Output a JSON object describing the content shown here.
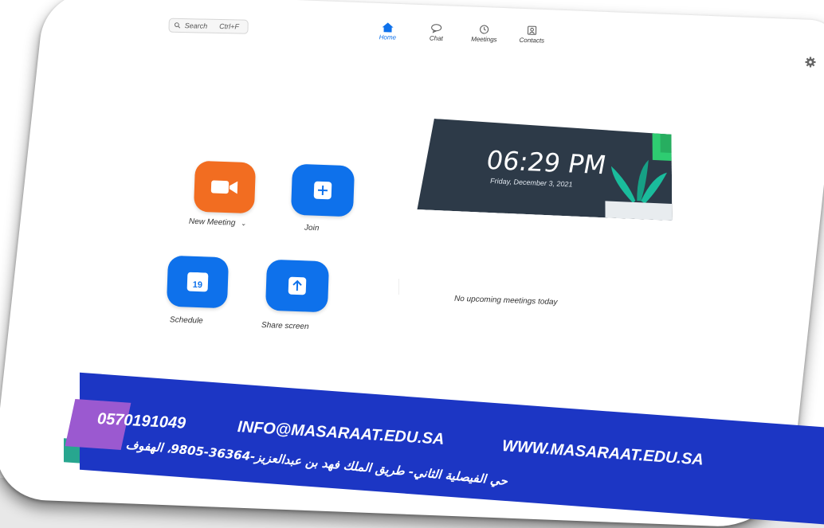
{
  "search": {
    "label": "Search",
    "shortcut": "Ctrl+F"
  },
  "tabs": [
    {
      "label": "Home"
    },
    {
      "label": "Chat"
    },
    {
      "label": "Meetings"
    },
    {
      "label": "Contacts"
    }
  ],
  "actions": {
    "new_meeting": "New Meeting",
    "join": "Join",
    "schedule": "Schedule",
    "calendar_day": "19",
    "share_screen": "Share screen"
  },
  "clock": {
    "time": "06:29 PM",
    "date": "Friday, December 3, 2021"
  },
  "meetings_status": "No upcoming meetings today",
  "footer": {
    "phone": "0570191049",
    "email": "INFO@MASARAAT.EDU.SA",
    "website": "WWW.MASARAAT.EDU.SA",
    "address": "حي الفيصلية الثاني- طريق الملك فهد بن عبدالعزيز-36364-9805، الهفوف"
  },
  "colors": {
    "accent": "#0e71eb",
    "new_meeting": "#f26d21",
    "clock_bg": "#2d3a48",
    "banner": "#1c36c4"
  },
  "icons": [
    "search-icon",
    "home-icon",
    "chat-icon",
    "meetings-icon",
    "contacts-icon",
    "gear-icon",
    "video-camera-icon",
    "plus-icon",
    "calendar-icon",
    "share-arrow-icon"
  ]
}
